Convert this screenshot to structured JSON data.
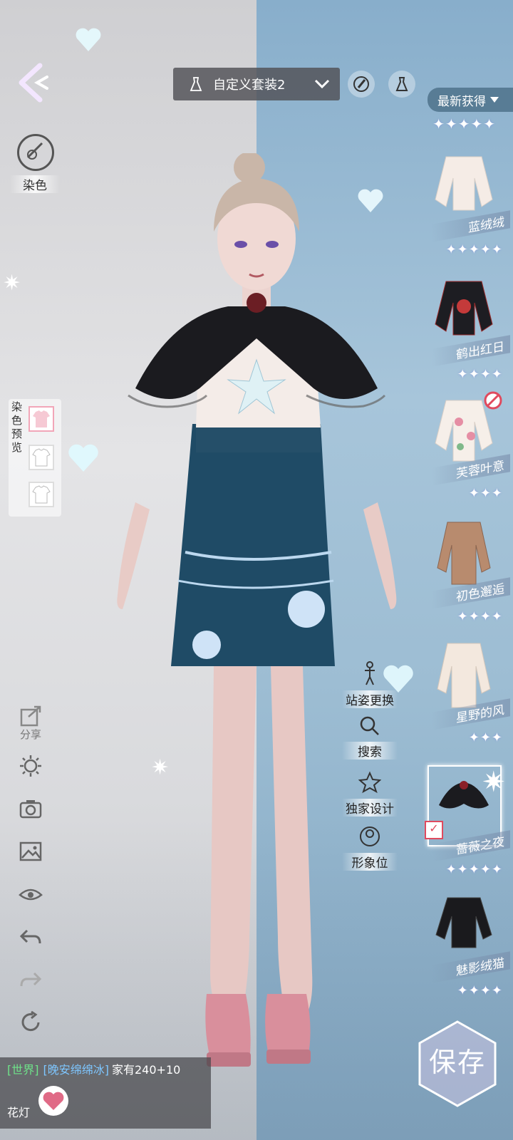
{
  "header": {
    "outfit_name": "自定义套装2",
    "sort_label": "最新获得"
  },
  "left_panel": {
    "dye_label": "染色",
    "dye_preview_label": "染色预览",
    "share_label": "分享"
  },
  "chat": {
    "channel": "[世界]",
    "user": "[晚安绵绵冰]",
    "message": "家有240+10",
    "line2": "花灯"
  },
  "mid_tools": [
    {
      "label": "站姿更换",
      "icon": "pose-icon"
    },
    {
      "label": "搜索",
      "icon": "search-icon"
    },
    {
      "label": "独家设计",
      "icon": "star-icon"
    },
    {
      "label": "形象位",
      "icon": "portrait-icon"
    }
  ],
  "items": [
    {
      "name": "蓝绒绒",
      "stars": "✦✦✦✦✦",
      "selected": false
    },
    {
      "name": "鹤出红日",
      "stars": "✦✦✦✦",
      "selected": false
    },
    {
      "name": "芙蓉叶意",
      "stars": "✦✦✦",
      "selected": false
    },
    {
      "name": "初色邂逅",
      "stars": "✦✦✦✦",
      "selected": false
    },
    {
      "name": "星野的风",
      "stars": "✦✦✦",
      "selected": false
    },
    {
      "name": "蔷薇之夜",
      "stars": "✦✦✦✦✦",
      "selected": true
    },
    {
      "name": "魅影绒猫",
      "stars": "✦✦✦✦",
      "selected": false
    }
  ],
  "top_stars": "✦✦✦✦✦",
  "save_label": "保存",
  "colors": {
    "left_bg": "#d9dadd",
    "right_bg": "#9dbdd3",
    "skirt": "#1f4b66",
    "shoes": "#d98f9c"
  }
}
